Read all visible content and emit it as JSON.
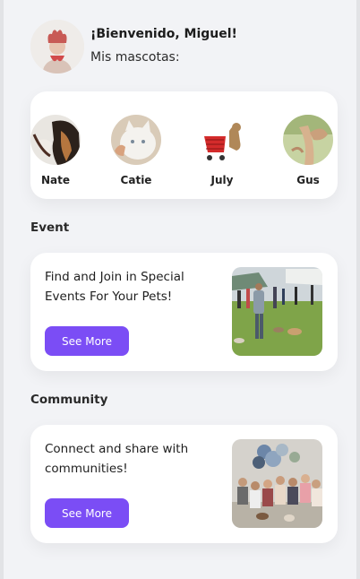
{
  "header": {
    "greeting": "¡Bienvenido, Miguel!",
    "subtitle": "Mis mascotas:"
  },
  "pets": [
    {
      "name": "Nate",
      "icon": "dog-photo-icon"
    },
    {
      "name": "Catie",
      "icon": "cat-photo-icon"
    },
    {
      "name": "July",
      "icon": "dog-cart-photo-icon"
    },
    {
      "name": "Gus",
      "icon": "pet-photo-icon"
    }
  ],
  "event": {
    "section_title": "Event",
    "text": "Find and Join in Special Events For Your Pets!",
    "button": "See More"
  },
  "community": {
    "section_title": "Community",
    "text": "Connect and share with communities!",
    "button": "See More"
  },
  "colors": {
    "accent": "#7b4df5",
    "background": "#f2f3f6",
    "card": "#ffffff"
  }
}
